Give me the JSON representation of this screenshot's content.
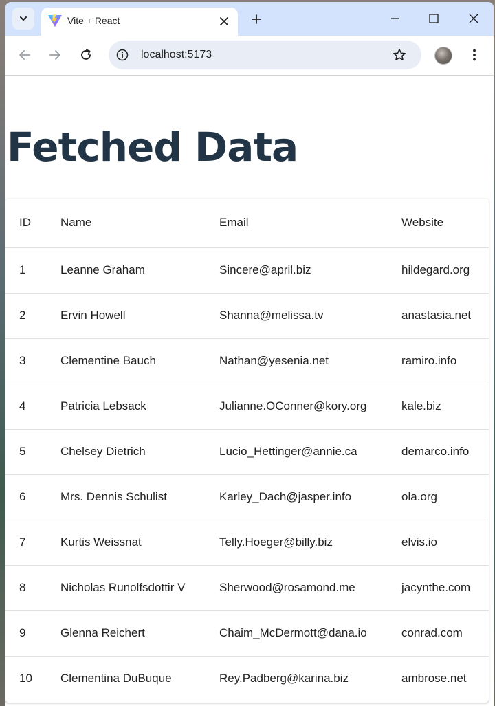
{
  "browser": {
    "tab": {
      "title": "Vite + React"
    },
    "url": "localhost:5173"
  },
  "page": {
    "title": "Fetched Data",
    "table": {
      "headers": [
        "ID",
        "Name",
        "Email",
        "Website"
      ],
      "rows": [
        [
          "1",
          "Leanne Graham",
          "Sincere@april.biz",
          "hildegard.org"
        ],
        [
          "2",
          "Ervin Howell",
          "Shanna@melissa.tv",
          "anastasia.net"
        ],
        [
          "3",
          "Clementine Bauch",
          "Nathan@yesenia.net",
          "ramiro.info"
        ],
        [
          "4",
          "Patricia Lebsack",
          "Julianne.OConner@kory.org",
          "kale.biz"
        ],
        [
          "5",
          "Chelsey Dietrich",
          "Lucio_Hettinger@annie.ca",
          "demarco.info"
        ],
        [
          "6",
          "Mrs. Dennis Schulist",
          "Karley_Dach@jasper.info",
          "ola.org"
        ],
        [
          "7",
          "Kurtis Weissnat",
          "Telly.Hoeger@billy.biz",
          "elvis.io"
        ],
        [
          "8",
          "Nicholas Runolfsdottir V",
          "Sherwood@rosamond.me",
          "jacynthe.com"
        ],
        [
          "9",
          "Glenna Reichert",
          "Chaim_McDermott@dana.io",
          "conrad.com"
        ],
        [
          "10",
          "Clementina DuBuque",
          "Rey.Padberg@karina.biz",
          "ambrose.net"
        ]
      ]
    }
  },
  "colors": {
    "titlebar": "#d3e3fd",
    "omnibox": "#e9eef6",
    "heading": "#213547"
  },
  "icons": [
    "tab-list-icon",
    "vite-logo-icon",
    "close-icon",
    "plus-icon",
    "minimize-icon",
    "maximize-icon",
    "back-arrow-icon",
    "forward-arrow-icon",
    "reload-icon",
    "site-info-icon",
    "star-icon",
    "kebab-menu-icon"
  ]
}
